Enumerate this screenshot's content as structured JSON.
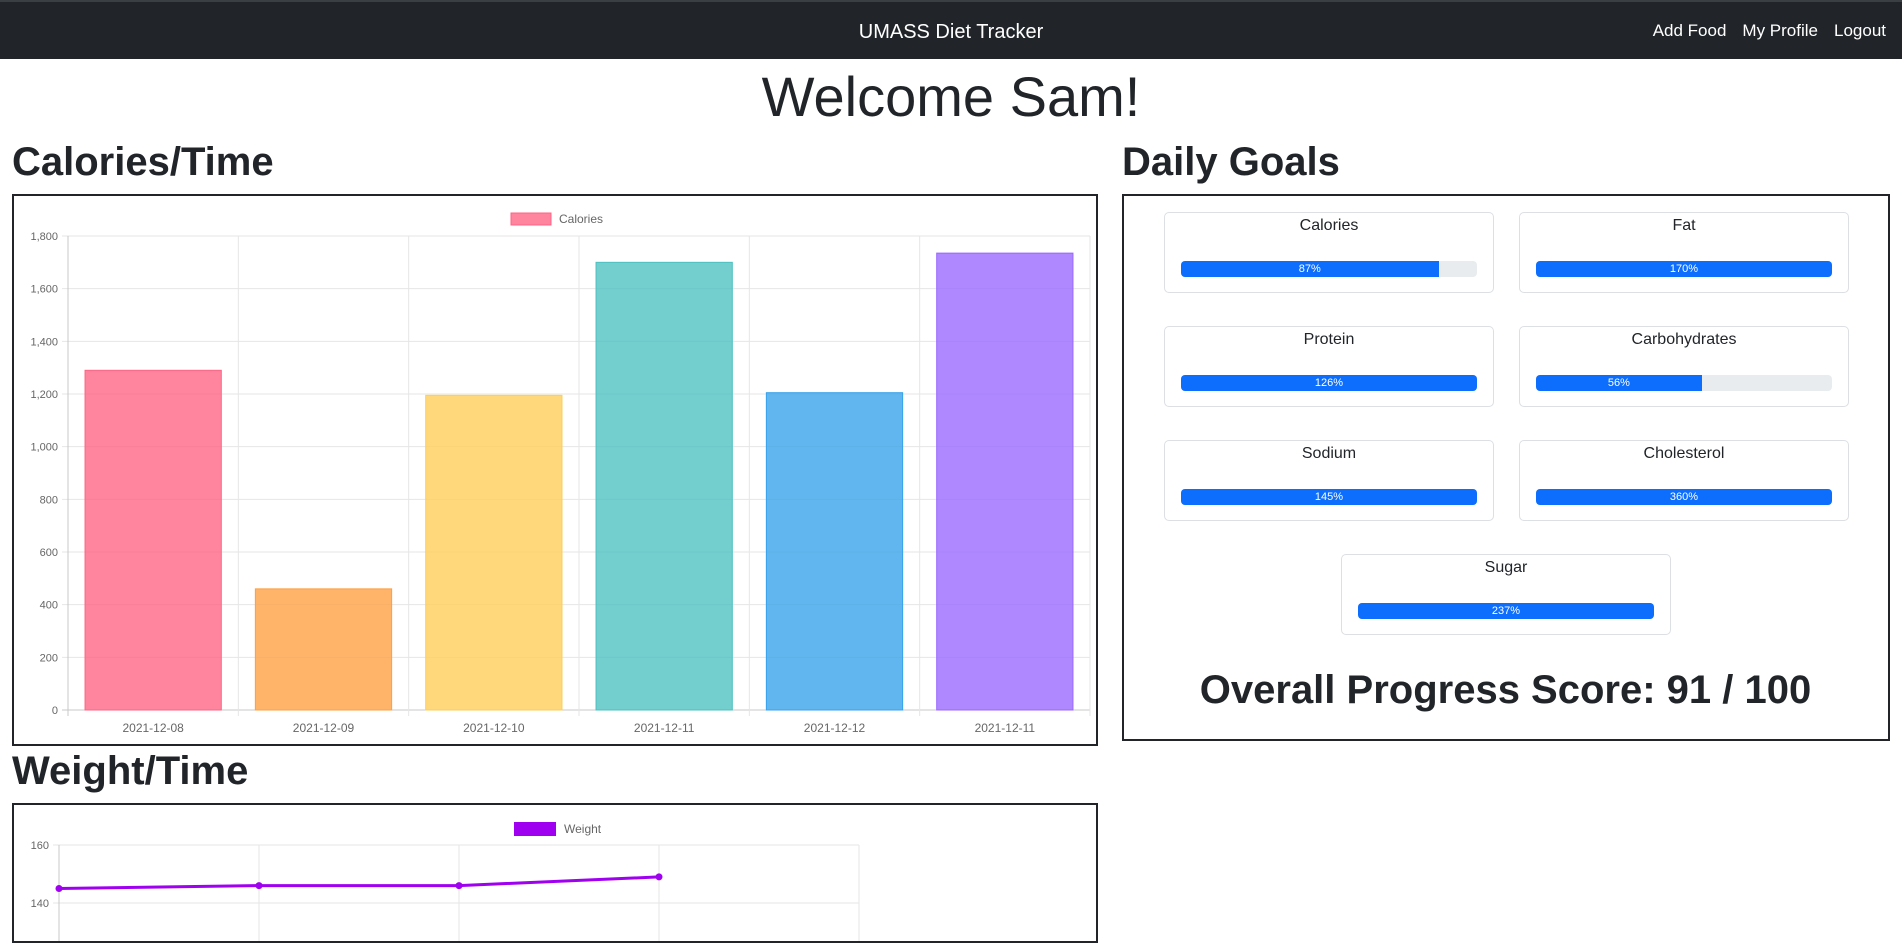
{
  "nav": {
    "brand": "UMASS Diet Tracker",
    "links": [
      "Add Food",
      "My Profile",
      "Logout"
    ]
  },
  "welcome": "Welcome Sam!",
  "sections": {
    "calories_title": "Calories/Time",
    "weight_title": "Weight/Time",
    "goals_title": "Daily Goals"
  },
  "goals": [
    {
      "label": "Calories",
      "percent": 87,
      "text": "87%"
    },
    {
      "label": "Fat",
      "percent": 170,
      "text": "170%"
    },
    {
      "label": "Protein",
      "percent": 126,
      "text": "126%"
    },
    {
      "label": "Carbohydrates",
      "percent": 56,
      "text": "56%"
    },
    {
      "label": "Sodium",
      "percent": 145,
      "text": "145%"
    },
    {
      "label": "Cholesterol",
      "percent": 360,
      "text": "360%"
    },
    {
      "label": "Sugar",
      "percent": 237,
      "text": "237%"
    }
  ],
  "overall_score": "Overall Progress Score: 91 / 100",
  "chart_data": [
    {
      "type": "bar",
      "legend": "Calories",
      "legend_position": "top",
      "categories": [
        "2021-12-08",
        "2021-12-09",
        "2021-12-10",
        "2021-12-11",
        "2021-12-12",
        "2021-12-11"
      ],
      "values": [
        1290,
        460,
        1195,
        1700,
        1205,
        1735
      ],
      "ylim": [
        0,
        1800
      ],
      "yticks": [
        "0",
        "200",
        "400",
        "600",
        "800",
        "1,000",
        "1,200",
        "1,400",
        "1,600",
        "1,800"
      ],
      "colors": [
        "#ff6384",
        "#ff9f40",
        "#ffcd56",
        "#4bc0c0",
        "#36a2eb",
        "#9966ff"
      ],
      "grid": true
    },
    {
      "type": "line",
      "legend": "Weight",
      "legend_position": "top",
      "x_count": 6,
      "values": [
        145,
        146,
        146,
        149
      ],
      "yticks": [
        "140",
        "160"
      ],
      "color": "#a000f0",
      "grid": true
    }
  ]
}
